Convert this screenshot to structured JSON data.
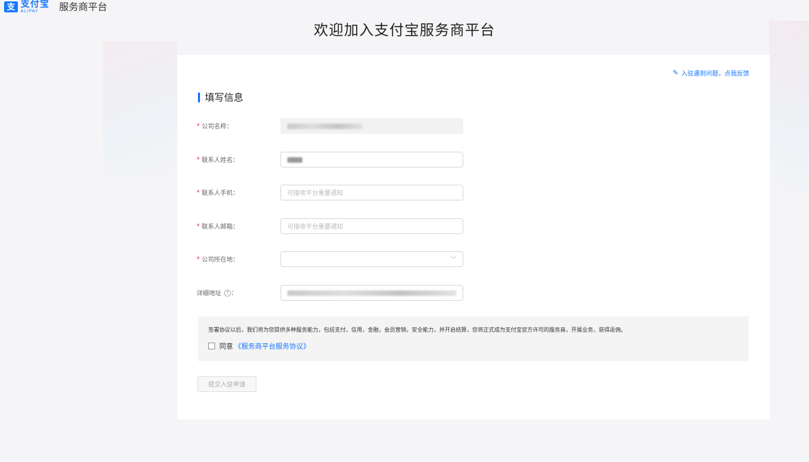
{
  "header": {
    "logo_icon": "支",
    "logo_cn": "支付宝",
    "logo_en": "ALIPAY",
    "title": "服务商平台"
  },
  "page_title": "欢迎加入支付宝服务商平台",
  "feedback": {
    "icon": "edit-icon",
    "label": "入驻遇到问题，点我反馈"
  },
  "section_title": "填写信息",
  "form": {
    "company_name": {
      "label": "公司名称：",
      "required": true,
      "value_redacted": true,
      "disabled": true
    },
    "contact_name": {
      "label": "联系人姓名：",
      "required": true,
      "value_redacted": true
    },
    "contact_phone": {
      "label": "联系人手机：",
      "required": true,
      "placeholder": "可接收平台重要通知"
    },
    "contact_email": {
      "label": "联系人邮箱：",
      "required": true,
      "placeholder": "可接收平台重要通知"
    },
    "company_location": {
      "label": "公司所在地：",
      "required": true,
      "value": ""
    },
    "address": {
      "label": "详细地址",
      "help": "?",
      "colon": "：",
      "required": false,
      "value_redacted": true
    }
  },
  "agreement": {
    "text": "签署协议以后，我们将为您提供多种服务能力，包括支付，信用，金融，会员营销，安全能力，并开启结算，您将正式成为支付宝官方许可的服务商，开展业务，获得返佣。",
    "agree_label": "同意",
    "link_text": "《服务商平台服务协议》",
    "checked": false
  },
  "submit_label": "提交入驻申请",
  "colors": {
    "accent": "#1677ff",
    "required": "#f5222d"
  }
}
